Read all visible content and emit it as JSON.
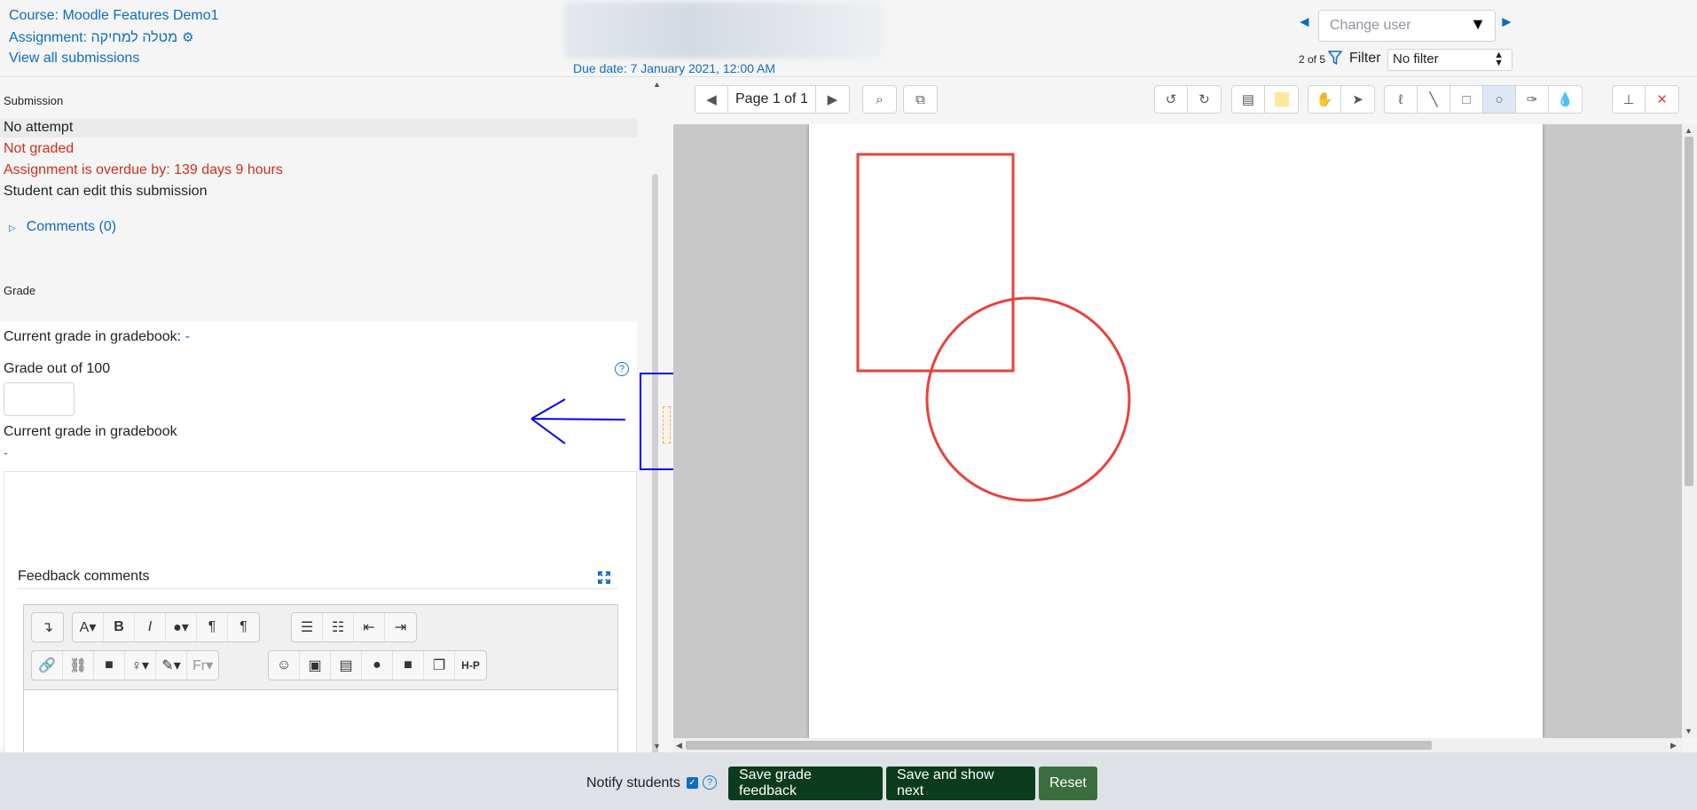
{
  "header": {
    "course_link": "Course: Moodle Features Demo1",
    "assignment_link": "Assignment: מטלה למחיקה",
    "view_all": "View all submissions",
    "due_date": "Due date: 7 January 2021, 12:00 AM",
    "change_user_placeholder": "Change user",
    "user_count": "2 of 5",
    "filter_label": "Filter",
    "filter_value": "No filter"
  },
  "submission": {
    "title": "Submission",
    "status": "No attempt",
    "grading_status": "Not graded",
    "overdue": "Assignment is overdue by: 139 days 9 hours",
    "edit_status": "Student can edit this submission",
    "comments": "Comments (0)"
  },
  "grade": {
    "title": "Grade",
    "current_label": "Current grade in gradebook: ",
    "current_value": "-",
    "out_of": "Grade out of 100",
    "help": "?",
    "current_label2": "Current grade in gradebook",
    "current_value2": "-"
  },
  "feedback": {
    "title": "Feedback comments",
    "toolbar_row1": [
      {
        "icon": "collapse-icon",
        "glyph": "↴"
      },
      {
        "icon": "font-size-icon",
        "glyph": "A▾"
      },
      {
        "icon": "bold-icon",
        "glyph": "B"
      },
      {
        "icon": "italic-icon",
        "glyph": "I"
      },
      {
        "icon": "font-color-icon",
        "glyph": "●▾"
      },
      {
        "icon": "ltr-icon",
        "glyph": "¶"
      },
      {
        "icon": "rtl-icon",
        "glyph": "¶"
      },
      {
        "icon": "unordered-list-icon",
        "glyph": "☰"
      },
      {
        "icon": "ordered-list-icon",
        "glyph": "☷"
      },
      {
        "icon": "outdent-icon",
        "glyph": "⇤"
      },
      {
        "icon": "indent-icon",
        "glyph": "⇥"
      }
    ],
    "toolbar_row2": [
      {
        "icon": "link-icon",
        "glyph": "🔗"
      },
      {
        "icon": "unlink-icon",
        "glyph": "⛓"
      },
      {
        "icon": "background-color-icon",
        "glyph": "■"
      },
      {
        "icon": "bulb-icon",
        "glyph": "♀▾"
      },
      {
        "icon": "brush-icon",
        "glyph": "✎▾"
      },
      {
        "icon": "font-family-icon",
        "glyph": "Fr▾"
      },
      {
        "icon": "emoji-icon",
        "glyph": "☺"
      },
      {
        "icon": "image-icon",
        "glyph": "▣"
      },
      {
        "icon": "media-icon",
        "glyph": "▤"
      },
      {
        "icon": "microphone-icon",
        "glyph": "●"
      },
      {
        "icon": "video-icon",
        "glyph": "■"
      },
      {
        "icon": "copy-icon",
        "glyph": "❐"
      },
      {
        "icon": "h5p-icon",
        "glyph": "H-P"
      }
    ]
  },
  "pdf": {
    "page_label": "Page 1 of 1",
    "annotation_color": "#e8423b"
  },
  "footer": {
    "notify_label": "Notify students",
    "notify_checked": true,
    "save_feedback": "Save grade feedback",
    "save_next": "Save and show next",
    "reset": "Reset"
  },
  "colors": {
    "link": "#0f6cbf",
    "error": "#ca3120",
    "primary_button": "#0a3c1c",
    "highlight_annotation": "#0000ff"
  }
}
